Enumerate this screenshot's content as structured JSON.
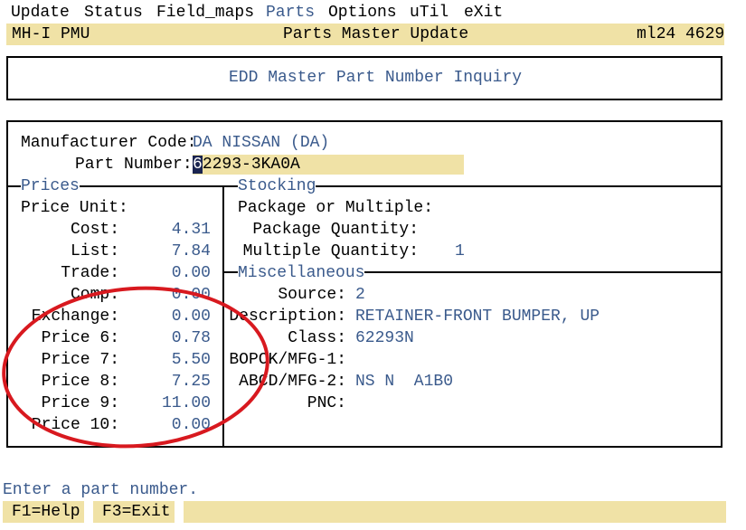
{
  "menu": {
    "update": "Update",
    "status": "Status",
    "field_maps": "Field_maps",
    "parts": "Parts",
    "options": "Options",
    "util": "uTil",
    "exit": "eXit"
  },
  "titlebar": {
    "left": "MH-I PMU",
    "center": "Parts Master Update",
    "right": "ml24 4629"
  },
  "header_box": {
    "title": "EDD Master Part Number Inquiry"
  },
  "form": {
    "manufacturer_label": "Manufacturer Code:",
    "manufacturer_value": "DA NISSAN (DA)",
    "part_number_label": "Part Number:",
    "part_number_first_char": "6",
    "part_number_rest": "2293-3KA0A"
  },
  "prices": {
    "legend": "Prices",
    "price_unit_label": "Price Unit:",
    "rows": [
      {
        "label": "Cost:",
        "value": "4.31"
      },
      {
        "label": "List:",
        "value": "7.84"
      },
      {
        "label": "Trade:",
        "value": "0.00"
      },
      {
        "label": "Comp:",
        "value": "0.00"
      },
      {
        "label": "Exchange:",
        "value": "0.00"
      },
      {
        "label": "Price 6:",
        "value": "0.78"
      },
      {
        "label": "Price 7:",
        "value": "5.50"
      },
      {
        "label": "Price 8:",
        "value": "7.25"
      },
      {
        "label": "Price 9:",
        "value": "11.00"
      },
      {
        "label": "Price 10:",
        "value": "0.00"
      }
    ]
  },
  "stocking": {
    "legend": "Stocking",
    "package_or_multiple_label": "Package or Multiple:",
    "package_quantity_label": "Package Quantity:",
    "multiple_quantity_label": "Multiple Quantity:",
    "multiple_quantity_value": "1"
  },
  "misc": {
    "legend": "Miscellaneous",
    "source_label": "Source:",
    "source_value": "2",
    "description_label": "Description:",
    "description_value": "RETAINER-FRONT BUMPER, UP",
    "class_label": "Class:",
    "class_value": "62293N",
    "bopck_label": "BOPCK/MFG-1:",
    "abcd_label": "ABCD/MFG-2:",
    "abcd_value": "NS N  A1B0",
    "pnc_label": "PNC:"
  },
  "status_message": "Enter a part number.",
  "fkeys": {
    "f1": "F1=Help",
    "f3": "F3=Exit"
  },
  "annotation": {
    "color": "#d8191f",
    "shape": "ellipse"
  },
  "colors": {
    "bar": "#f0e2a6",
    "field_text": "#3a5a8c",
    "annotation": "#d8191f"
  }
}
